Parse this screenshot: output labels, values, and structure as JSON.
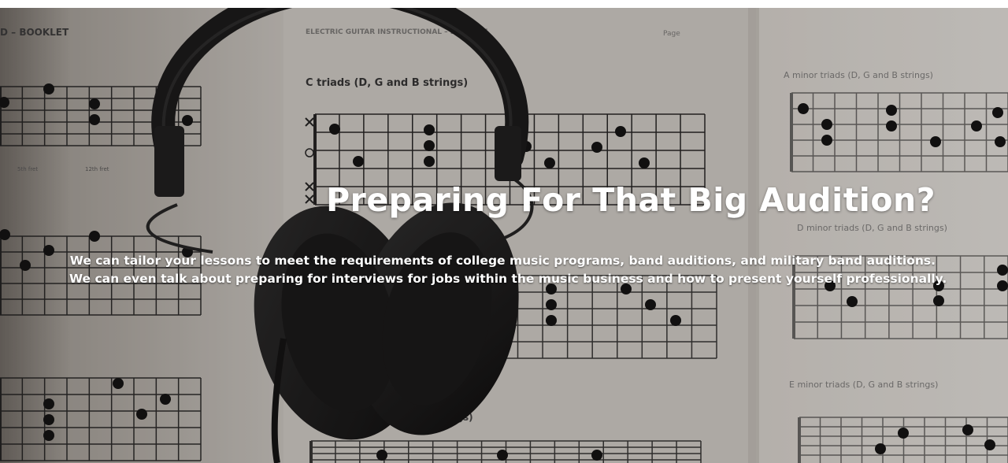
{
  "hero": {
    "background": {
      "icon": "sheet-music-with-headphones-image",
      "sheet_text": {
        "left_header": "D – BOOKLET",
        "center_header": "ELECTRIC GUITAR INSTRUCTIONAL – BOOKLET",
        "page": "Page",
        "c_triads": "C triads (D, G and B strings)",
        "a_minor": "A minor triads (D, G and B strings)",
        "d_minor": "D minor triads (D, G and B strings)",
        "e_minor": "E minor triads (D, G and B strings)",
        "strings": "strings)",
        "fret_1": "5th fret",
        "fret_2": "12th fret"
      }
    },
    "title": "Preparing For That Big Audition?",
    "description_line_1": "We can tailor your lessons to meet the requirements of college music programs, band auditions, and military band auditions.",
    "description_line_2": "We can even talk about preparing for interviews for jobs within the music business and how to present yourself professionally."
  },
  "colors": {
    "text": "#ffffff",
    "paper": "#d9d5cf",
    "headphones": "#1b1b1b"
  }
}
